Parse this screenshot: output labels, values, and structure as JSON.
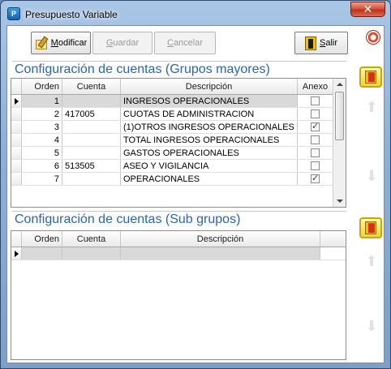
{
  "window": {
    "title": "Presupuesto Variable",
    "close_label": "✕"
  },
  "toolbar": {
    "modificar_pre": "",
    "modificar_u": "M",
    "modificar_post": "odificar",
    "guardar_pre": "",
    "guardar_u": "G",
    "guardar_post": "uardar",
    "cancelar_pre": "",
    "cancelar_u": "C",
    "cancelar_post": "ancelar",
    "salir_pre": "",
    "salir_u": "S",
    "salir_post": "alir"
  },
  "section1": {
    "title": "Configuración de cuentas (Grupos mayores)",
    "columns": {
      "orden": "Orden",
      "cuenta": "Cuenta",
      "descripcion": "Descripción",
      "anexo": "Anexo"
    },
    "rows": [
      {
        "orden": "1",
        "cuenta": "",
        "descripcion": "INGRESOS OPERACIONALES",
        "anexo": false,
        "selected": true
      },
      {
        "orden": "2",
        "cuenta": "417005",
        "descripcion": "CUOTAS DE ADMINISTRACION",
        "anexo": false
      },
      {
        "orden": "3",
        "cuenta": "",
        "descripcion": "(1)OTROS INGRESOS OPERACIONALES",
        "anexo": true
      },
      {
        "orden": "4",
        "cuenta": "",
        "descripcion": "TOTAL INGRESOS OPERACIONALES",
        "anexo": false
      },
      {
        "orden": "5",
        "cuenta": "",
        "descripcion": "GASTOS OPERACIONALES",
        "anexo": false
      },
      {
        "orden": "6",
        "cuenta": "513505",
        "descripcion": "ASEO Y VIGILANCIA",
        "anexo": false
      },
      {
        "orden": "7",
        "cuenta": "",
        "descripcion": "OPERACIONALES",
        "anexo": true
      }
    ]
  },
  "section2": {
    "title": "Configuración de cuentas (Sub grupos)",
    "columns": {
      "orden": "Orden",
      "cuenta": "Cuenta",
      "descripcion": "Descripción"
    }
  },
  "icons": {
    "modificar": "pencil-icon",
    "salir": "exit-door-icon",
    "help": "help-lifebuoy-icon",
    "side": "exit-row-icon",
    "up": "arrow-up-icon",
    "down": "arrow-down-icon",
    "up_glyph": "⬆",
    "down_glyph": "⬇"
  }
}
